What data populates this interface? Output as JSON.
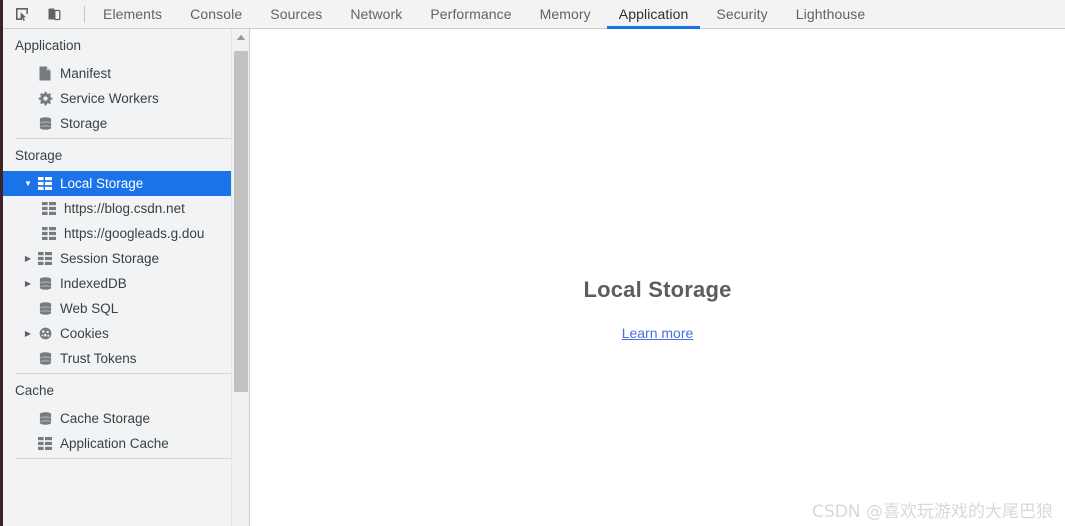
{
  "toolbar": {
    "icons": [
      {
        "name": "inspect-element-icon",
        "title": "Inspect element"
      },
      {
        "name": "device-toolbar-icon",
        "title": "Toggle device toolbar"
      }
    ],
    "tabs": [
      {
        "label": "Elements",
        "active": false
      },
      {
        "label": "Console",
        "active": false
      },
      {
        "label": "Sources",
        "active": false
      },
      {
        "label": "Network",
        "active": false
      },
      {
        "label": "Performance",
        "active": false
      },
      {
        "label": "Memory",
        "active": false
      },
      {
        "label": "Application",
        "active": true
      },
      {
        "label": "Security",
        "active": false
      },
      {
        "label": "Lighthouse",
        "active": false
      }
    ],
    "active_tab": "Application",
    "active_underline_color": "#1a73e8"
  },
  "sidebar": {
    "sections": [
      {
        "title": "Application",
        "items": [
          {
            "label": "Manifest",
            "icon": "manifest-document-icon",
            "indent": 1,
            "twisty": "none",
            "selected": false
          },
          {
            "label": "Service Workers",
            "icon": "gear-icon",
            "indent": 1,
            "twisty": "none",
            "selected": false
          },
          {
            "label": "Storage",
            "icon": "database-stack-icon",
            "indent": 1,
            "twisty": "none",
            "selected": false
          }
        ]
      },
      {
        "title": "Storage",
        "items": [
          {
            "label": "Local Storage",
            "icon": "table-grid-icon",
            "indent": 1,
            "twisty": "expanded",
            "selected": true
          },
          {
            "label": "https://blog.csdn.net",
            "icon": "table-grid-icon",
            "indent": 2,
            "twisty": "none",
            "selected": false
          },
          {
            "label": "https://googleads.g.dou",
            "icon": "table-grid-icon",
            "indent": 2,
            "twisty": "none",
            "selected": false
          },
          {
            "label": "Session Storage",
            "icon": "table-grid-icon",
            "indent": 1,
            "twisty": "collapsed",
            "selected": false
          },
          {
            "label": "IndexedDB",
            "icon": "database-stack-icon",
            "indent": 1,
            "twisty": "collapsed",
            "selected": false
          },
          {
            "label": "Web SQL",
            "icon": "database-stack-icon",
            "indent": 1,
            "twisty": "none",
            "selected": false
          },
          {
            "label": "Cookies",
            "icon": "cookie-icon",
            "indent": 1,
            "twisty": "collapsed",
            "selected": false
          },
          {
            "label": "Trust Tokens",
            "icon": "database-stack-icon",
            "indent": 1,
            "twisty": "none",
            "selected": false
          }
        ]
      },
      {
        "title": "Cache",
        "items": [
          {
            "label": "Cache Storage",
            "icon": "database-stack-icon",
            "indent": 1,
            "twisty": "none",
            "selected": false
          },
          {
            "label": "Application Cache",
            "icon": "table-grid-icon",
            "indent": 1,
            "twisty": "none",
            "selected": false
          }
        ]
      }
    ],
    "selected_item": "Local Storage",
    "selection_color": "#1a73e8"
  },
  "scrollbar": {
    "up_arrow_icon": "scroll-up-arrow-icon",
    "thumb_color": "#c1c1c1"
  },
  "main": {
    "empty_title": "Local Storage",
    "learn_more_label": "Learn more",
    "link_color": "#4a6fe0"
  },
  "watermark": {
    "text": "CSDN @喜欢玩游戏的大尾巴狼"
  }
}
